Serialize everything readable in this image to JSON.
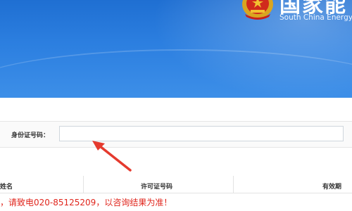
{
  "header": {
    "brand_cn": "国家能",
    "brand_en": "South China Energy"
  },
  "search": {
    "label": "身份证号码：",
    "value": "",
    "placeholder": ""
  },
  "table": {
    "columns": [
      "姓名",
      "许可证号码",
      "有效期"
    ]
  },
  "notice": "，请致电020-85125209，以咨询结果为准！",
  "colors": {
    "banner": "#2c7fe0",
    "notice": "#e0251c",
    "arrow": "#e53a2e"
  }
}
